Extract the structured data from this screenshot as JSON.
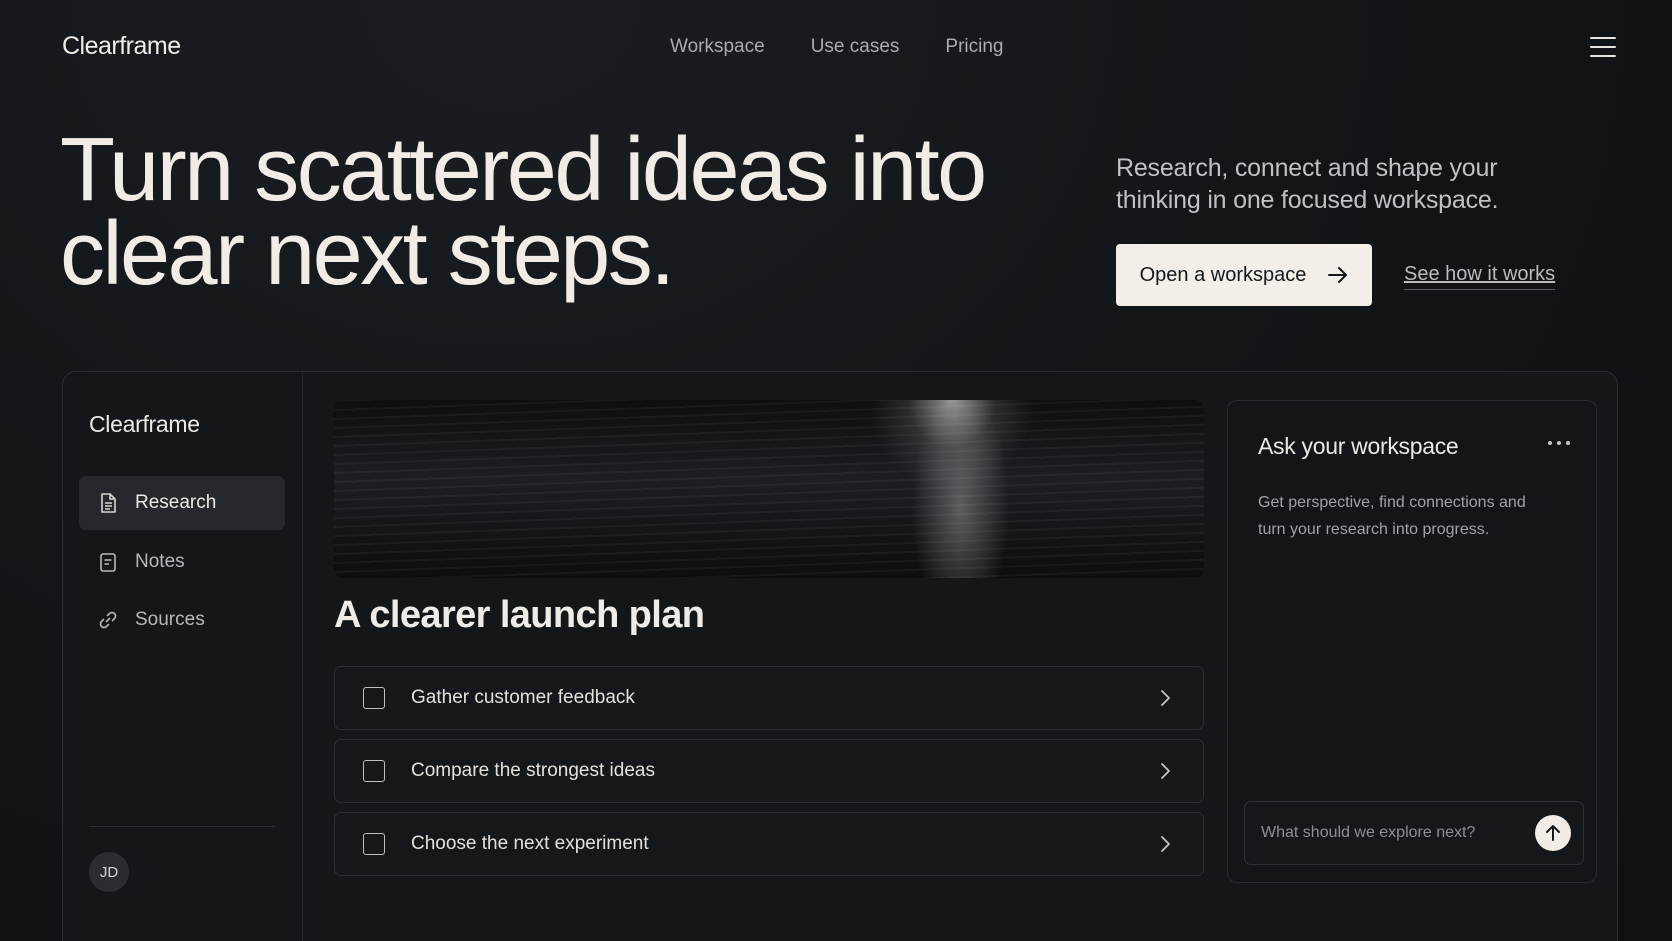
{
  "nav": {
    "brand": "Clearframe",
    "links": [
      "Workspace",
      "Use cases",
      "Pricing"
    ],
    "menu_icon": "hamburger-menu-icon"
  },
  "hero": {
    "title": "Turn scattered ideas into clear next steps.",
    "subtitle": "Research, connect and shape your thinking in one focused workspace.",
    "cta_primary": "Open a workspace",
    "cta_secondary": "See how it works"
  },
  "app": {
    "sidebar": {
      "brand": "Clearframe",
      "items": [
        {
          "label": "Research",
          "icon": "document-icon",
          "active": true
        },
        {
          "label": "Notes",
          "icon": "note-icon",
          "active": false
        },
        {
          "label": "Sources",
          "icon": "link-icon",
          "active": false
        }
      ],
      "avatar_initials": "JD"
    },
    "main": {
      "plan_title": "A clearer launch plan",
      "tasks": [
        {
          "label": "Gather customer feedback",
          "checked": false
        },
        {
          "label": "Compare the strongest ideas",
          "checked": false
        },
        {
          "label": "Choose the next experiment",
          "checked": false
        }
      ]
    },
    "ask": {
      "title": "Ask your workspace",
      "description": "Get perspective, find connections and turn your research into progress.",
      "input_placeholder": "What should we explore next?"
    }
  },
  "colors": {
    "background": "#111417",
    "cta_background": "#f3efe8",
    "active_item": "#25292e"
  }
}
